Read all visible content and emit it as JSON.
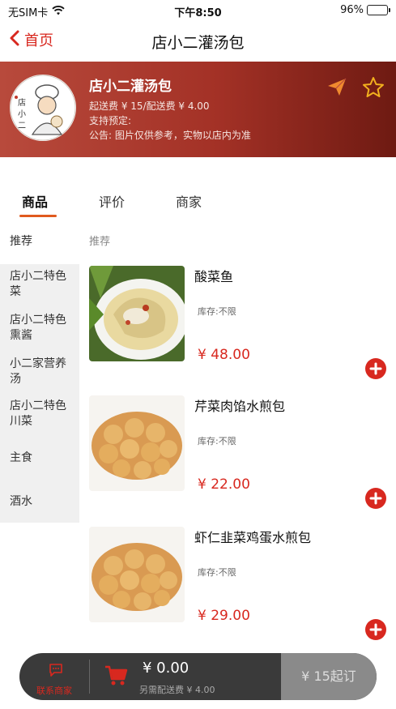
{
  "status_bar": {
    "carrier": "无SIM卡",
    "time": "下午8:50",
    "battery": "96%"
  },
  "nav": {
    "back_label": "首页",
    "title": "店小二灌汤包"
  },
  "shop": {
    "name": "店小二灌汤包",
    "delivery": "起送费 ¥ 15/配送费 ¥ 4.00",
    "preorder": "支持预定:",
    "notice": "公告: 图片仅供参考，实物以店内为准",
    "logo_text": "店小二"
  },
  "tabs": [
    {
      "label": "商品",
      "active": true
    },
    {
      "label": "评价",
      "active": false
    },
    {
      "label": "商家",
      "active": false
    }
  ],
  "sidebar": {
    "items": [
      {
        "label": "推荐",
        "active": true
      },
      {
        "label": "店小二特色菜"
      },
      {
        "label": "店小二特色熏酱"
      },
      {
        "label": "小二家营养汤"
      },
      {
        "label": "店小二特色川菜"
      },
      {
        "label": "主食"
      },
      {
        "label": "酒水"
      }
    ]
  },
  "category_header": "推荐",
  "products": [
    {
      "name": "酸菜鱼",
      "stock": "库存:不限",
      "price": "¥ 48.00",
      "image": "pickled-fish"
    },
    {
      "name": "芹菜肉馅水煎包",
      "stock": "库存:不限",
      "price": "¥ 22.00",
      "image": "pan-fried-buns"
    },
    {
      "name": "虾仁韭菜鸡蛋水煎包",
      "stock": "库存:不限",
      "price": "¥ 29.00",
      "image": "pan-fried-buns"
    }
  ],
  "cart": {
    "service_label": "联系商家",
    "amount": "¥ 0.00",
    "fee": "另需配送费 ¥ 4.00",
    "checkout": "¥ 15起订"
  },
  "colors": {
    "accent": "#d8281f",
    "header_gradient_start": "#b84a3c",
    "header_gradient_end": "#6e1a12",
    "tab_underline": "#e05a1e",
    "star": "#f2b01e",
    "send": "#f08a2e"
  }
}
